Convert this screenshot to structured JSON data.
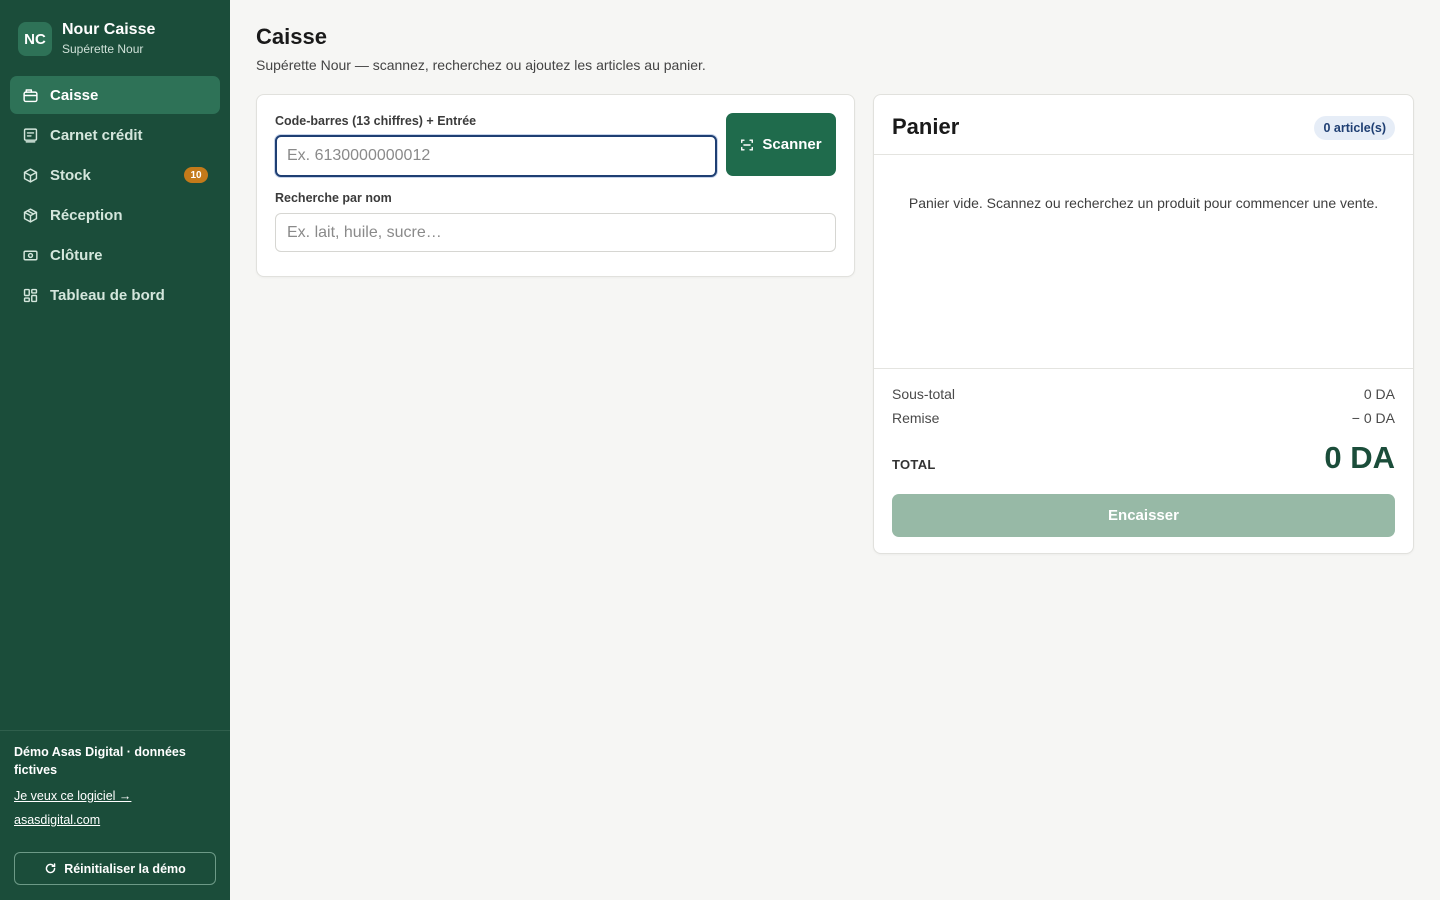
{
  "brand": {
    "initials": "NC",
    "name": "Nour Caisse",
    "subtitle": "Supérette Nour"
  },
  "nav": {
    "items": [
      {
        "label": "Caisse",
        "icon": "cash-register-icon",
        "active": true
      },
      {
        "label": "Carnet crédit",
        "icon": "ledger-icon"
      },
      {
        "label": "Stock",
        "icon": "box-icon",
        "badge": "10"
      },
      {
        "label": "Réception",
        "icon": "package-icon"
      },
      {
        "label": "Clôture",
        "icon": "banknote-icon"
      },
      {
        "label": "Tableau de bord",
        "icon": "dashboard-icon"
      }
    ]
  },
  "footer": {
    "demo_note": "Démo Asas Digital · données fictives",
    "cta_link": "Je veux ce logiciel →",
    "site_link": "asasdigital.com",
    "reset_label": "Réinitialiser la démo"
  },
  "page": {
    "title": "Caisse",
    "subtitle": "Supérette Nour — scannez, recherchez ou ajoutez les articles au panier."
  },
  "scan": {
    "barcode_label": "Code-barres (13 chiffres) + Entrée",
    "barcode_placeholder": "Ex. 6130000000012",
    "barcode_value": "",
    "scanner_label": "Scanner",
    "search_label": "Recherche par nom",
    "search_placeholder": "Ex. lait, huile, sucre…",
    "search_value": ""
  },
  "cart": {
    "title": "Panier",
    "count": "0 article(s)",
    "empty_message": "Panier vide. Scannez ou recherchez un produit pour commencer une vente.",
    "subtotal_label": "Sous-total",
    "subtotal_value": "0 DA",
    "discount_label": "Remise",
    "discount_value": "− 0 DA",
    "total_label": "TOTAL",
    "total_value": "0 DA",
    "pay_label": "Encaisser"
  },
  "colors": {
    "sidebar": "#1b4d3a",
    "accent": "#1f6b4c",
    "active_nav": "#2e7257",
    "badge": "#c47a1a",
    "pay_disabled": "#97b9a6",
    "focus_ring": "#1f3f73"
  }
}
